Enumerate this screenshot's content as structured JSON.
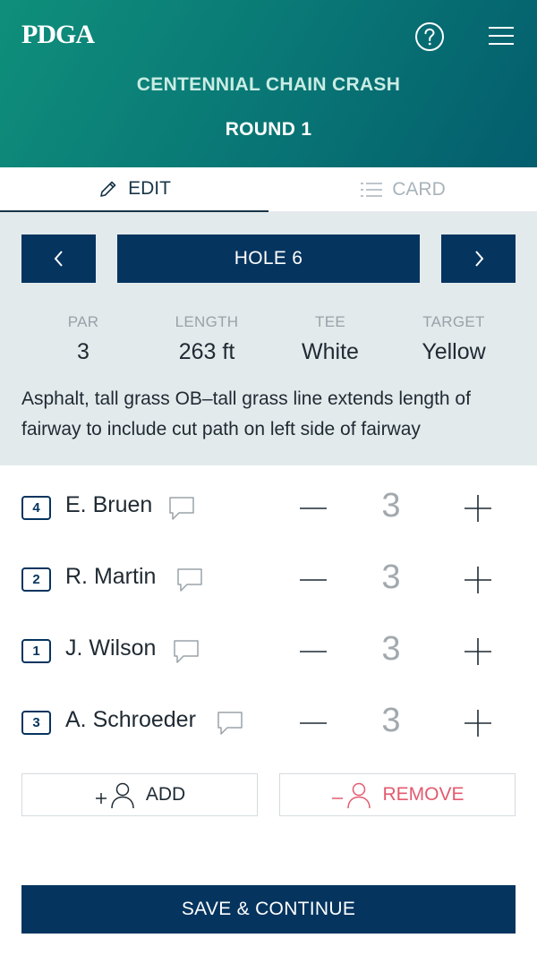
{
  "header": {
    "logo": "PDGA",
    "event_name": "CENTENNIAL CHAIN CRASH",
    "round": "ROUND 1",
    "help_icon": "help-circle-icon",
    "menu_icon": "hamburger-menu-icon"
  },
  "tabs": [
    {
      "label": "EDIT",
      "icon": "pencil-icon",
      "active": true
    },
    {
      "label": "CARD",
      "icon": "list-icon",
      "active": false
    }
  ],
  "hole": {
    "label": "HOLE 6",
    "prev_icon": "chevron-left-icon",
    "next_icon": "chevron-right-icon",
    "stats": [
      {
        "label": "PAR",
        "value": "3"
      },
      {
        "label": "LENGTH",
        "value": "263 ft"
      },
      {
        "label": "TEE",
        "value": "White"
      },
      {
        "label": "TARGET",
        "value": "Yellow"
      }
    ],
    "description": "Asphalt, tall grass OB–tall grass line extends length of fairway to include cut path on left side of fairway"
  },
  "players": [
    {
      "position": "4",
      "name": "E. Bruen",
      "score": "3"
    },
    {
      "position": "2",
      "name": "R. Martin",
      "score": "3"
    },
    {
      "position": "1",
      "name": "J. Wilson",
      "score": "3"
    },
    {
      "position": "3",
      "name": "A. Schroeder",
      "score": "3"
    }
  ],
  "actions": {
    "add_label": "ADD",
    "remove_label": "REMOVE",
    "save_label": "SAVE & CONTINUE"
  },
  "colors": {
    "header_start": "#0f8f7b",
    "header_end": "#035d6d",
    "navy": "#05345f",
    "remove_red": "#e35a6e",
    "panel_bg": "#e3eaec"
  }
}
